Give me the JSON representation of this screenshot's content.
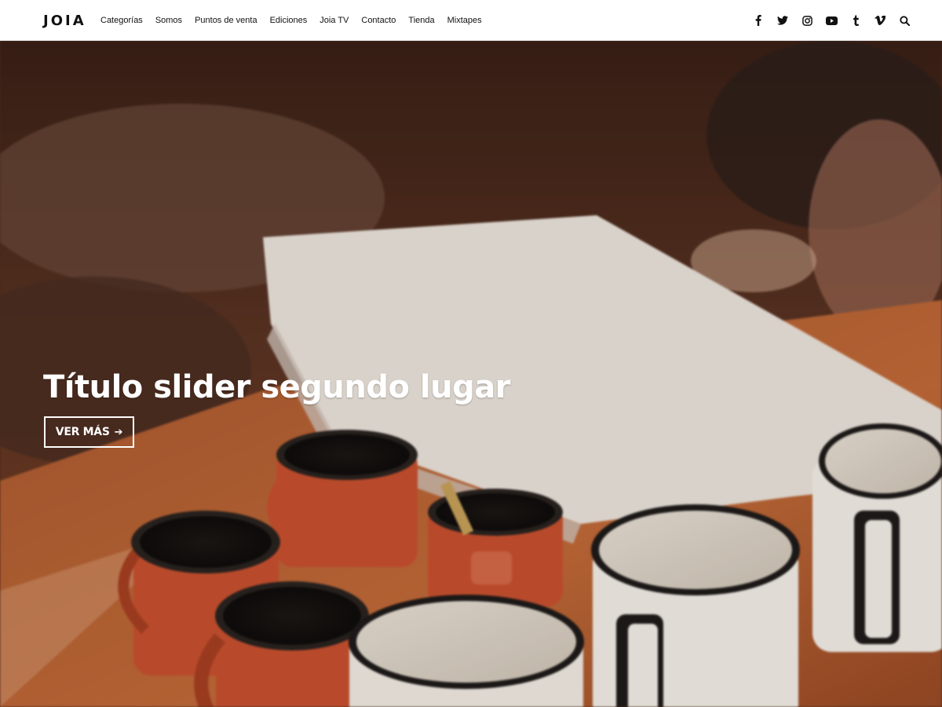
{
  "header": {
    "logo": "JOIA",
    "nav": [
      "Categorías",
      "Somos",
      "Puntos de venta",
      "Ediciones",
      "Joia TV",
      "Contacto",
      "Tienda",
      "Mixtapes"
    ],
    "social_icons": [
      "facebook-icon",
      "twitter-icon",
      "instagram-icon",
      "youtube-icon",
      "tumblr-icon",
      "vimeo-icon",
      "search-icon"
    ]
  },
  "hero": {
    "title": "Título slider segundo lugar",
    "cta_label": "VER MÁS",
    "cta_arrow": "➔",
    "image_description_colors": {
      "table": "#b86a3c",
      "background": "#3b241a",
      "orange_mug": "#c8512f",
      "white_mug": "#f1ebe2"
    }
  }
}
